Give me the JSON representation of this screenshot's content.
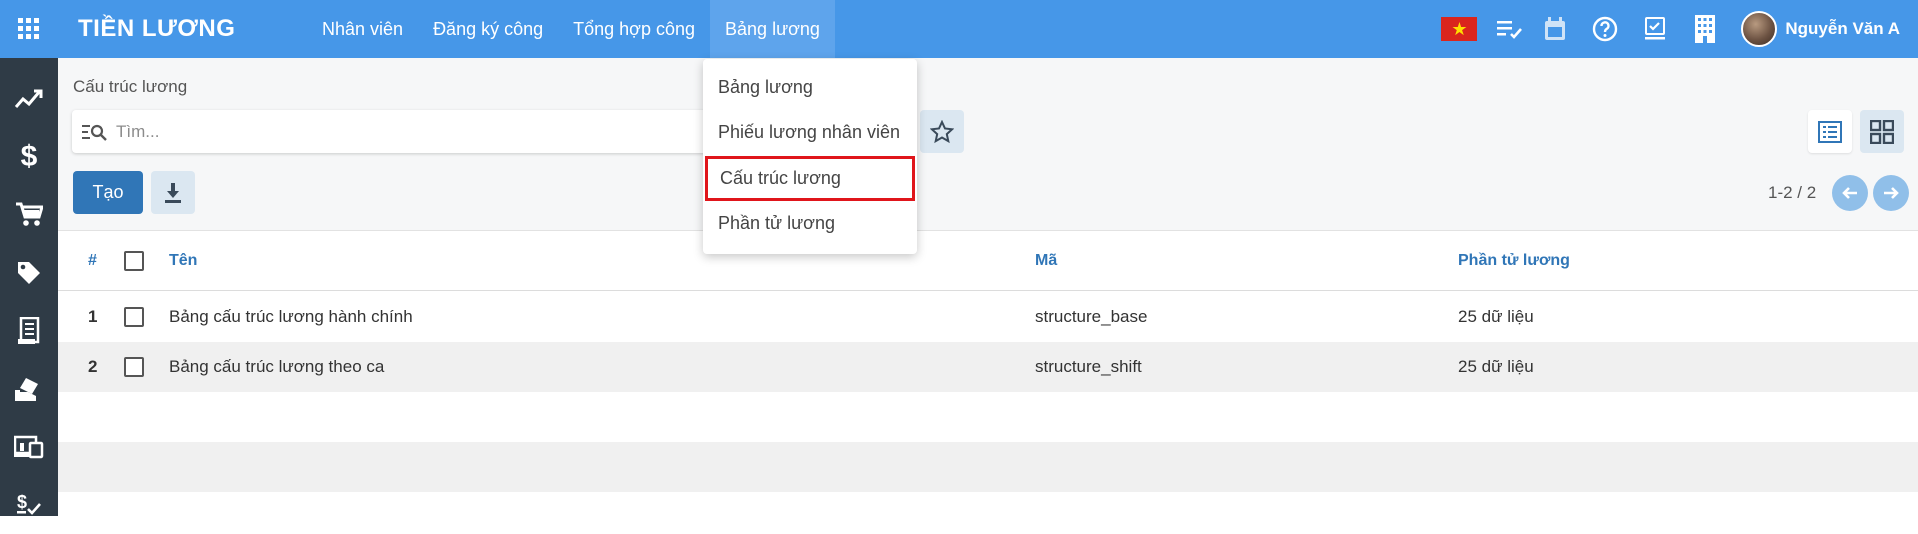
{
  "app": {
    "title": "TIỀN LƯƠNG"
  },
  "menu": [
    {
      "label": "Nhân viên"
    },
    {
      "label": "Đăng ký công"
    },
    {
      "label": "Tổng hợp công"
    },
    {
      "label": "Bảng lương"
    }
  ],
  "user": {
    "name": "Nguyễn Văn A"
  },
  "breadcrumb": "Cấu trúc lương",
  "search": {
    "placeholder": "Tìm..."
  },
  "buttons": {
    "create": "Tạo"
  },
  "pager": {
    "text": "1-2 / 2"
  },
  "dropdown": [
    {
      "label": "Bảng lương"
    },
    {
      "label": "Phiếu lương nhân viên"
    },
    {
      "label": "Cấu trúc lương"
    },
    {
      "label": "Phần tử lương"
    }
  ],
  "table": {
    "columns": {
      "num": "#",
      "name": "Tên",
      "code": "Mã",
      "elements": "Phần tử lương"
    },
    "rows": [
      {
        "num": "1",
        "name": "Bảng cấu trúc lương hành chính",
        "code": "structure_base",
        "elements": "25 dữ liệu"
      },
      {
        "num": "2",
        "name": "Bảng cấu trúc lương theo ca",
        "code": "structure_shift",
        "elements": "25 dữ liệu"
      }
    ]
  },
  "colors": {
    "topbar": "#4697e8",
    "sidebar": "#2f3b46",
    "primary": "#3076b7",
    "highlight": "#e0151b"
  },
  "icons": {
    "sidebar": [
      "chart-line-icon",
      "dollar-icon",
      "cart-icon",
      "tag-icon",
      "receipt-icon",
      "money-hand-icon",
      "devices-icon",
      "salary-check-icon"
    ]
  }
}
